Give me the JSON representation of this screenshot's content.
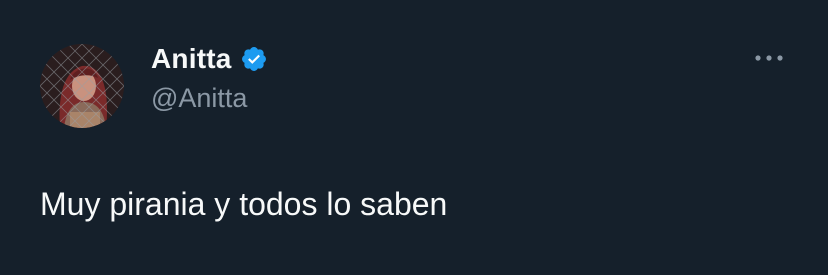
{
  "tweet": {
    "author": {
      "display_name": "Anitta",
      "handle": "@Anitta",
      "verified": true,
      "avatar_icon": "user-avatar"
    },
    "text": "Muy pirania y todos lo saben",
    "more_icon": "more-horizontal-icon"
  },
  "colors": {
    "background": "#15202b",
    "primary_text": "#f7f9f9",
    "secondary_text": "#8b98a5",
    "verified_badge": "#1d9bf0"
  }
}
